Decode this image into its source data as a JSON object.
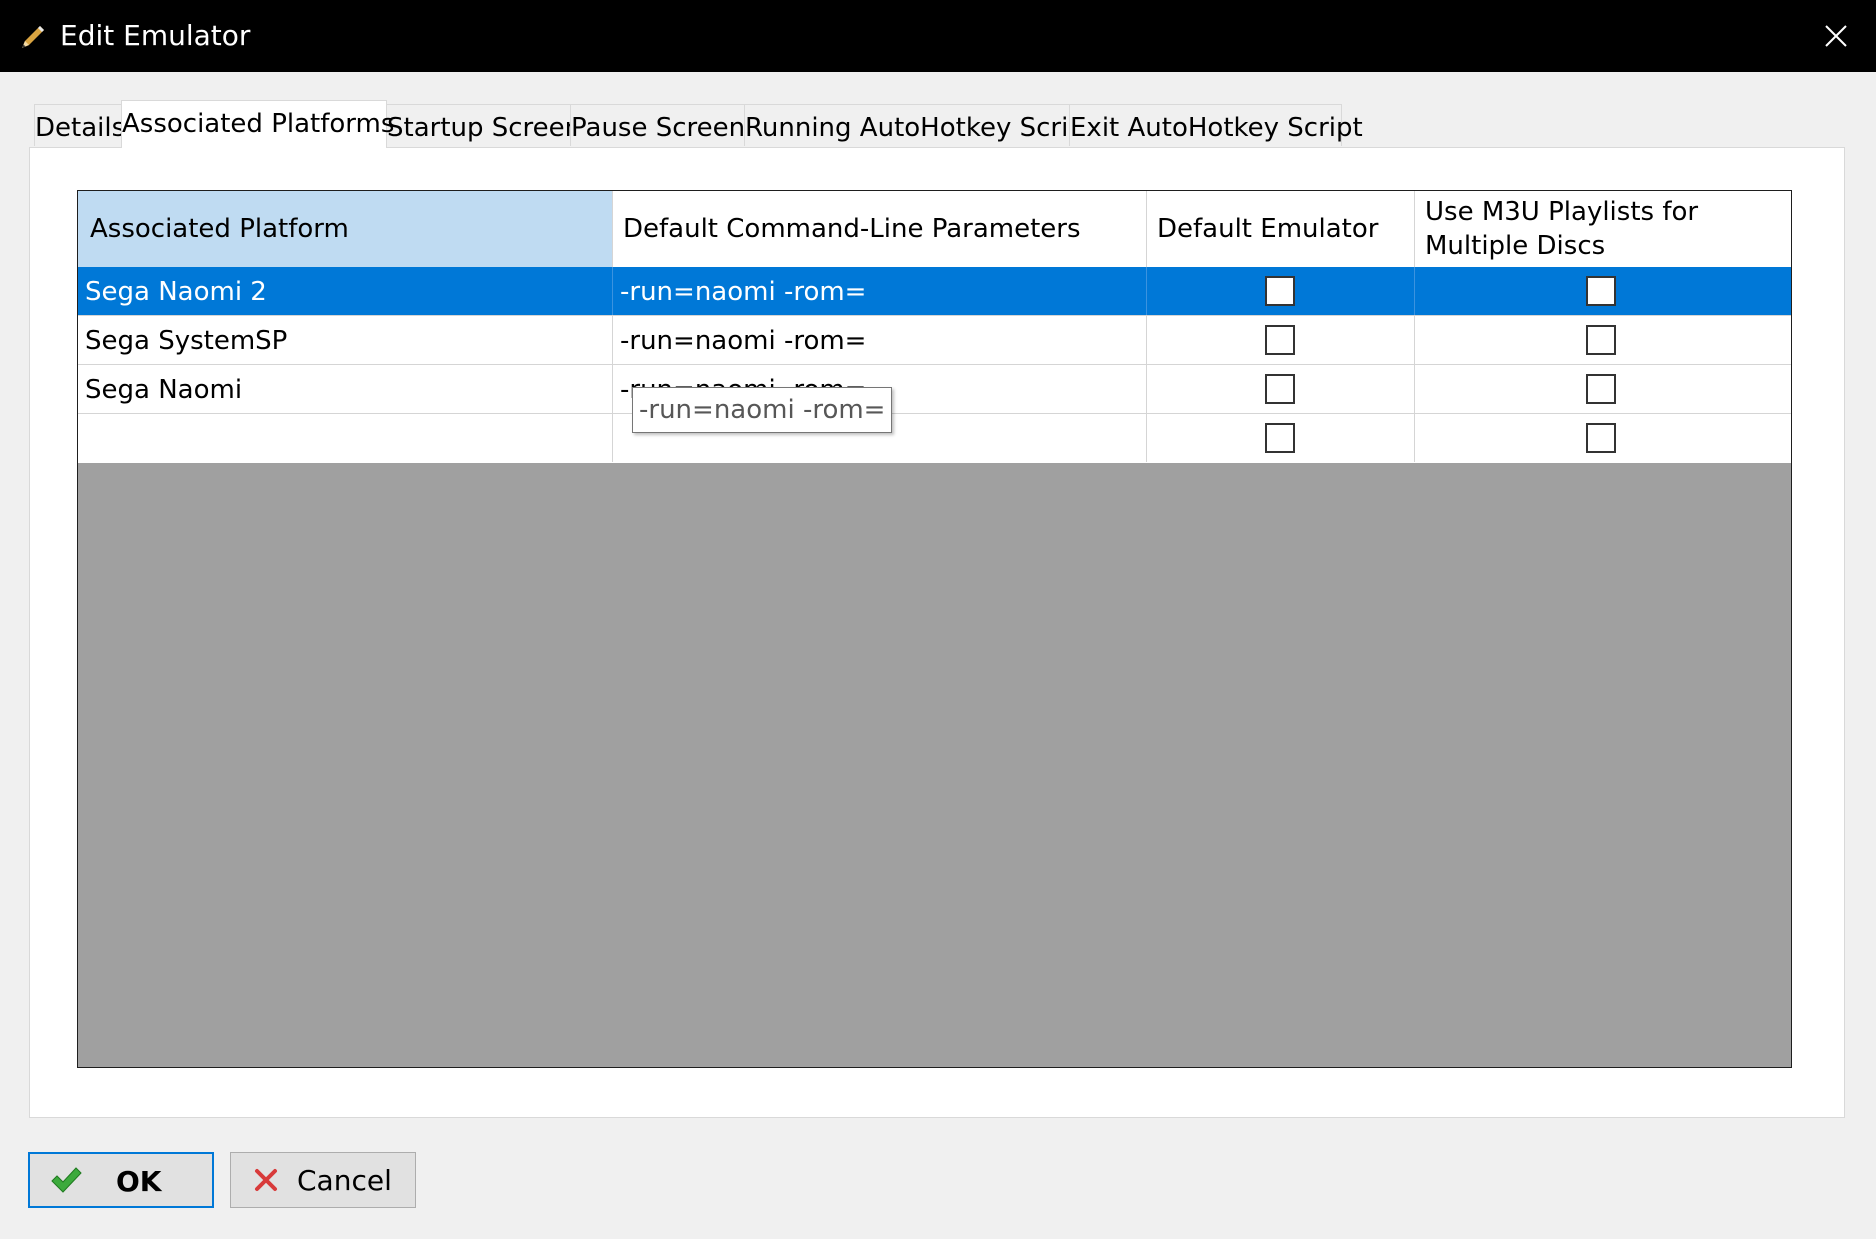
{
  "window": {
    "title": "Edit Emulator",
    "title_icon": "pencil-icon",
    "close_icon": "close-icon"
  },
  "tabs": [
    {
      "label": "Details",
      "active": false
    },
    {
      "label": "Associated Platforms",
      "active": true
    },
    {
      "label": "Startup Screen",
      "active": false
    },
    {
      "label": "Pause Screen",
      "active": false
    },
    {
      "label": "Running AutoHotkey Script",
      "active": false
    },
    {
      "label": "Exit AutoHotkey Script",
      "active": false
    }
  ],
  "grid": {
    "columns": [
      "Associated Platform",
      "Default Command-Line Parameters",
      "Default Emulator",
      "Use M3U Playlists for Multiple Discs"
    ],
    "rows": [
      {
        "platform": "Sega Naomi 2",
        "params": "-run=naomi -rom=",
        "default_emulator": false,
        "use_m3u": false,
        "selected": true
      },
      {
        "platform": "Sega SystemSP",
        "params": "-run=naomi -rom=",
        "default_emulator": false,
        "use_m3u": false,
        "selected": false
      },
      {
        "platform": "Sega Naomi",
        "params": "-run=naomi -rom=",
        "default_emulator": false,
        "use_m3u": false,
        "selected": false
      },
      {
        "platform": "",
        "params": "",
        "default_emulator": false,
        "use_m3u": false,
        "selected": false
      }
    ],
    "tooltip": "-run=naomi -rom="
  },
  "buttons": {
    "ok_label": "OK",
    "ok_icon": "checkmark-icon",
    "cancel_label": "Cancel",
    "cancel_icon": "x-icon"
  },
  "colors": {
    "titlebar": "#000000",
    "selection": "#0078d7",
    "header_selected": "#bfdbf2",
    "grid_background": "#a0a0a0"
  }
}
